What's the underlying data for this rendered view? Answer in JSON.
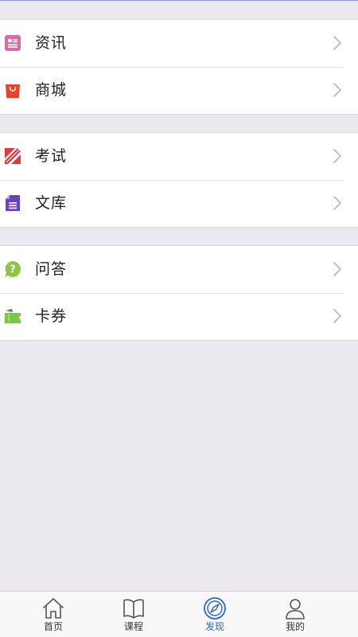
{
  "colors": {
    "background": "#ebe9ef",
    "row_background": "#ffffff",
    "text": "#222222",
    "chevron": "#b9b9be",
    "active_tab": "#2a6bc4",
    "inactive_tab": "#555555"
  },
  "groups": [
    {
      "items": [
        {
          "label": "资讯",
          "icon": "news-icon",
          "icon_color": "#d86ca8"
        },
        {
          "label": "商城",
          "icon": "shopping-bag-icon",
          "icon_color": "#e8442a"
        }
      ]
    },
    {
      "items": [
        {
          "label": "考试",
          "icon": "exam-pencil-icon",
          "icon_color": "#e03a3e"
        },
        {
          "label": "文库",
          "icon": "document-icon",
          "icon_color": "#6a3fc7"
        }
      ]
    },
    {
      "items": [
        {
          "label": "问答",
          "icon": "question-bubble-icon",
          "icon_color": "#8ec63f"
        },
        {
          "label": "卡券",
          "icon": "ticket-icon",
          "icon_color": "#7ac943"
        }
      ]
    }
  ],
  "tabbar": {
    "tabs": [
      {
        "label": "首页",
        "icon": "home-icon",
        "active": false
      },
      {
        "label": "课程",
        "icon": "book-icon",
        "active": false
      },
      {
        "label": "发现",
        "icon": "compass-icon",
        "active": true
      },
      {
        "label": "我的",
        "icon": "person-icon",
        "active": false
      }
    ]
  }
}
